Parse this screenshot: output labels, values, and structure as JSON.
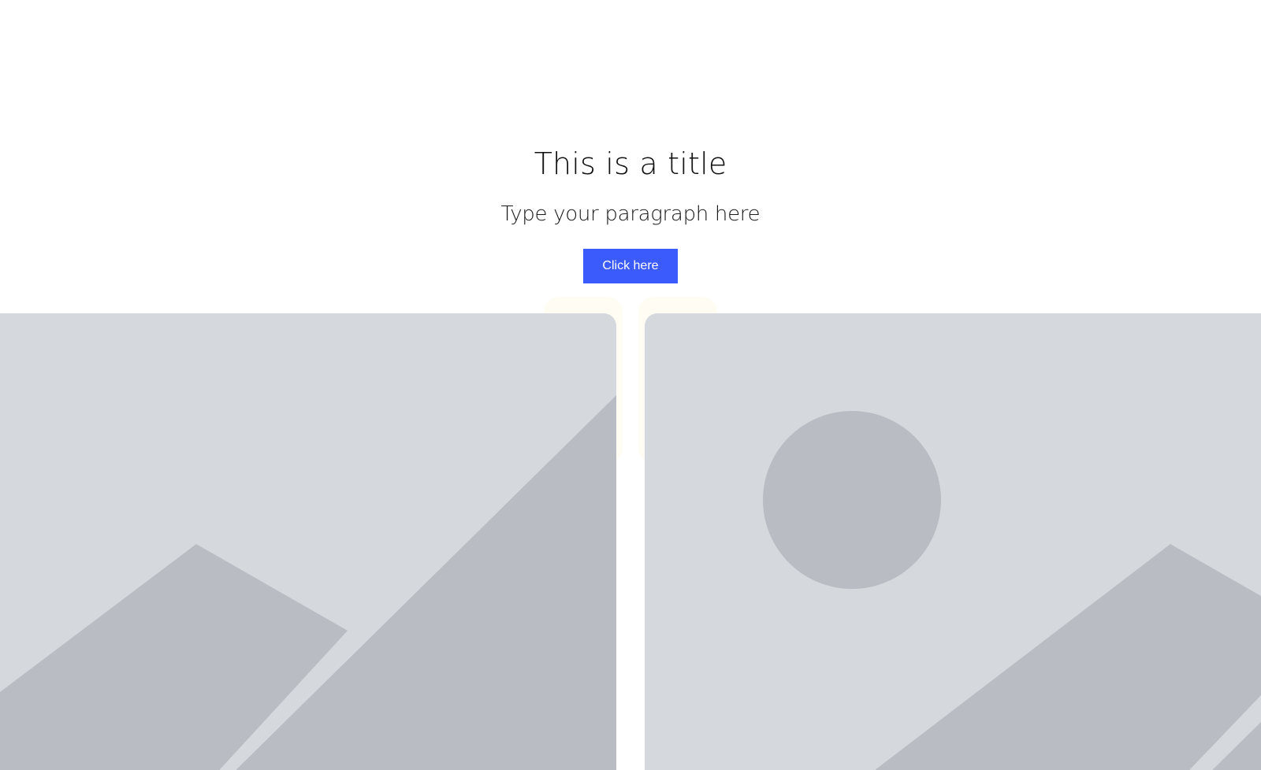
{
  "hero": {
    "title": "This is a title",
    "paragraph": "Type your paragraph here",
    "button_label": "Click here"
  },
  "images": [
    {
      "icon": "image-placeholder-icon"
    },
    {
      "icon": "image-placeholder-icon"
    }
  ],
  "colors": {
    "accent": "#3b5bfd",
    "placeholder_bg": "#d5d8dc",
    "placeholder_shape": "#b9bdc3",
    "text": "#111111"
  }
}
